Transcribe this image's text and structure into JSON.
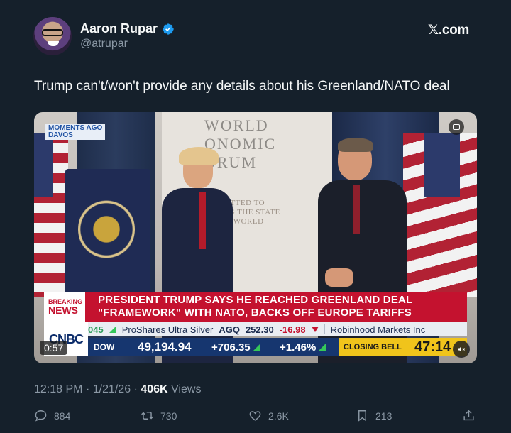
{
  "author": {
    "display_name": "Aaron Rupar",
    "handle": "@atrupar",
    "verified": true
  },
  "brand": "𝕏.com",
  "tweet": {
    "text": "Trump can't/won't provide any details about his Greenland/NATO deal"
  },
  "video": {
    "corner_tag_line1": "MOMENTS AGO",
    "corner_tag_line2": "DAVOS",
    "backdrop_logo_lines": [
      "WORLD",
      "ONOMIC",
      "ORUM"
    ],
    "backdrop_motto_lines": [
      "MITTED TO",
      "ING THE STATE",
      "HE WORLD"
    ],
    "breaking_label_1": "BREAKING",
    "breaking_label_2": "NEWS",
    "headline_line1": "PRESIDENT TRUMP SAYS HE REACHED GREENLAND DEAL",
    "headline_line2": "\"FRAMEWORK\" WITH NATO, BACKS OFF EUROPE TARIFFS",
    "network_logo": "CNBC",
    "ticker": {
      "left_value": "045",
      "item1_name": "ProShares Ultra Silver",
      "item1_symbol": "AGQ",
      "item1_price": "252.30",
      "item1_change": "-16.98",
      "item2_name": "Robinhood Markets Inc"
    },
    "index": {
      "name": "DOW",
      "value": "49,194.94",
      "change": "+706.35",
      "percent": "+1.46%"
    },
    "closing_bell_label": "CLOSING BELL",
    "closing_bell_time": "47:14",
    "playback_time": "0:57",
    "colors": {
      "breaking_red": "#c4122f",
      "index_blue": "#16366f",
      "closing_yellow": "#f0c41b"
    }
  },
  "meta": {
    "time": "12:18 PM",
    "date": "1/21/26",
    "views_count": "406K",
    "views_label": "Views"
  },
  "actions": {
    "replies": "884",
    "reposts": "730",
    "likes": "2.6K",
    "bookmarks": "213"
  },
  "icons": [
    "verified-badge-icon",
    "comment-icon",
    "repost-icon",
    "heart-icon",
    "bookmark-icon",
    "share-icon",
    "mute-icon",
    "picture-in-picture-icon"
  ]
}
